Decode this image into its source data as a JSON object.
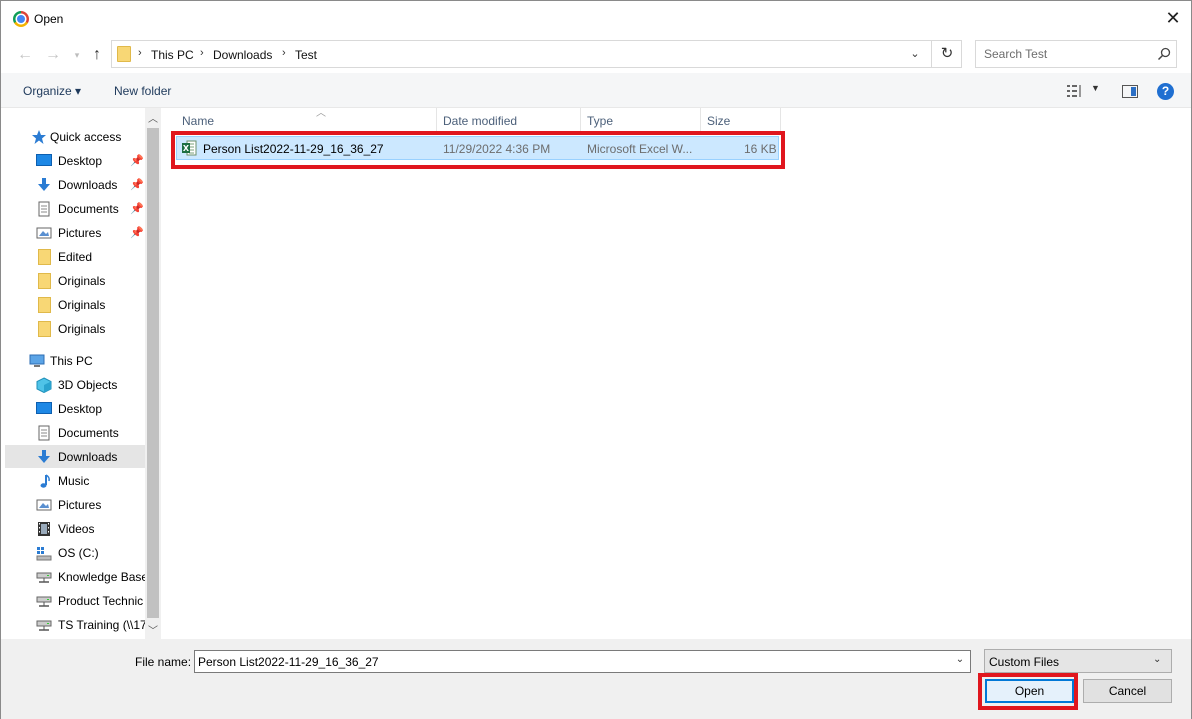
{
  "window": {
    "title": "Open"
  },
  "address": {
    "crumbs": [
      "This PC",
      "Downloads",
      "Test"
    ]
  },
  "search": {
    "placeholder": "Search Test"
  },
  "toolbar": {
    "organize": "Organize ▾",
    "new_folder": "New folder"
  },
  "nav": {
    "quick_access": "Quick access",
    "quick_items": [
      "Desktop",
      "Downloads",
      "Documents",
      "Pictures",
      "Edited",
      "Originals",
      "Originals",
      "Originals"
    ],
    "this_pc": "This PC",
    "pc_items": [
      "3D Objects",
      "Desktop",
      "Documents",
      "Downloads",
      "Music",
      "Pictures",
      "Videos",
      "OS (C:)",
      "Knowledge Base",
      "Product Technic",
      "TS Training (\\\\17"
    ]
  },
  "columns": {
    "name": "Name",
    "date": "Date modified",
    "type": "Type",
    "size": "Size"
  },
  "files": [
    {
      "name": "Person List2022-11-29_16_36_27",
      "date": "11/29/2022 4:36 PM",
      "type": "Microsoft Excel W...",
      "size": "16 KB"
    }
  ],
  "footer": {
    "file_name_label": "File name:",
    "file_name_value": "Person List2022-11-29_16_36_27",
    "file_type": "Custom Files",
    "open": "Open",
    "cancel": "Cancel"
  },
  "colors": {
    "accent": "#0078d7",
    "highlight": "#e0161e",
    "selection": "#cce8ff"
  }
}
